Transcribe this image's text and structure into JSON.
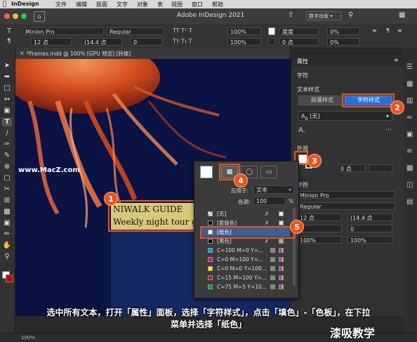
{
  "menu_bar": {
    "app_name": "InDesign",
    "items": [
      "文件",
      "编辑",
      "版面",
      "文字",
      "对象",
      "表",
      "视图",
      "窗口",
      "帮助"
    ]
  },
  "title_bar": {
    "title": "Adobe InDesign 2021",
    "workspace": "数字出版"
  },
  "control_bar": {
    "font_family": "Minion Pro",
    "font_style": "Regular",
    "font_size": "12 点",
    "leading": "(14.4 点",
    "tracking_a": "0",
    "tracking_b": "0",
    "scale_h": "100%",
    "scale_v": "100%",
    "baseline": "0 点",
    "skew": "0°",
    "degree_label": "度度",
    "pct_a": "0%",
    "pct_b": "0%"
  },
  "document_tab": {
    "label": "*Frames.indd @ 100% [GPU 预览] [转换]"
  },
  "canvas": {
    "text_line1": "NIWALK GUIDE",
    "text_line2": "Weekly night tour gu",
    "watermark": "www.MacZ.com"
  },
  "properties_panel": {
    "tab_title": "属性",
    "section_char": "字符",
    "section_text_style": "文本样式",
    "btn_paragraph_style": "段落样式",
    "btn_character_style": "字符样式",
    "style_value": "[无]",
    "section_appearance": "外观",
    "stroke_value": "0 点",
    "section_character": "字符",
    "font_family": "Minion Pro",
    "font_style": "Regular",
    "size": "12 点",
    "leading": "(14.4 点",
    "kerning": "0",
    "tracking": "0",
    "scale_h": "100%",
    "scale_v": "100%"
  },
  "swatches_popup": {
    "apply_label": "应用于:",
    "apply_value": "文本",
    "tint_label": "色调:",
    "tint_value": "100",
    "tint_unit": "%",
    "rows": [
      {
        "name": "[无]",
        "chip": "none"
      },
      {
        "name": "[套版色]",
        "chip": "#000000"
      },
      {
        "name": "[纸色]",
        "chip": "#ffffff",
        "selected": true
      },
      {
        "name": "[黑色]",
        "chip": "#000000"
      },
      {
        "name": "C=100 M=0 Y=...",
        "chip": "#00a0e3"
      },
      {
        "name": "C=0 M=100 Y=...",
        "chip": "#e4007f"
      },
      {
        "name": "C=0 M=0 Y=100...",
        "chip": "#fff100"
      },
      {
        "name": "C=15 M=100 Y=...",
        "chip": "#c8102e"
      },
      {
        "name": "C=75 M=5 Y=10...",
        "chip": "#009f4d"
      }
    ]
  },
  "callouts": {
    "n1": "1",
    "n2": "2",
    "n3": "3",
    "n4": "4",
    "n5": "5"
  },
  "caption": {
    "line1": "选中所有文本，打开「属性」面板，选择「字符样式」，点击「填色」-「色板」，在下拉",
    "line2": "菜单并选择「纸色」"
  },
  "status_bar": {
    "zoom": "100%",
    "watermark_corner": "漆吸教学"
  },
  "colors": {
    "accent_callout": "#e8541e",
    "canvas_bg": "#0b1344",
    "panel_bg": "#323232",
    "button_blue": "#2f6fd1"
  }
}
